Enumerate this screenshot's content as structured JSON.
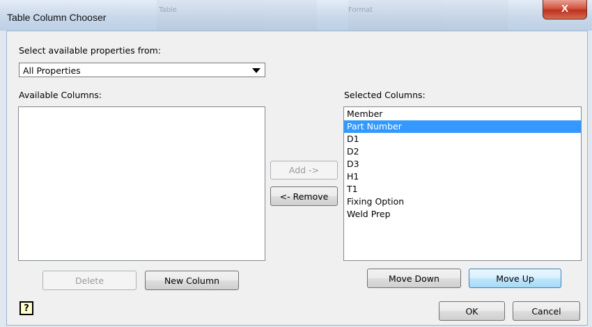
{
  "window": {
    "title": "Table Column Chooser",
    "close_symbol": "X",
    "background_tab_left": "Table",
    "background_tab_right": "Format"
  },
  "source": {
    "label": "Select available properties from:",
    "selected": "All Properties"
  },
  "available": {
    "label": "Available Columns:",
    "items": []
  },
  "selected_columns": {
    "label": "Selected Columns:",
    "items": [
      "Member",
      "Part Number",
      "D1",
      "D2",
      "D3",
      "H1",
      "T1",
      "Fixing Option",
      "Weld Prep"
    ],
    "selected_item": "Part Number"
  },
  "buttons": {
    "add": "Add ->",
    "remove": "<- Remove",
    "delete": "Delete",
    "new_column": "New Column",
    "move_down": "Move Down",
    "move_up": "Move Up",
    "ok": "OK",
    "cancel": "Cancel",
    "help_icon": "?"
  },
  "colors": {
    "selection": "#3399ff",
    "close_button": "#c7422d"
  }
}
